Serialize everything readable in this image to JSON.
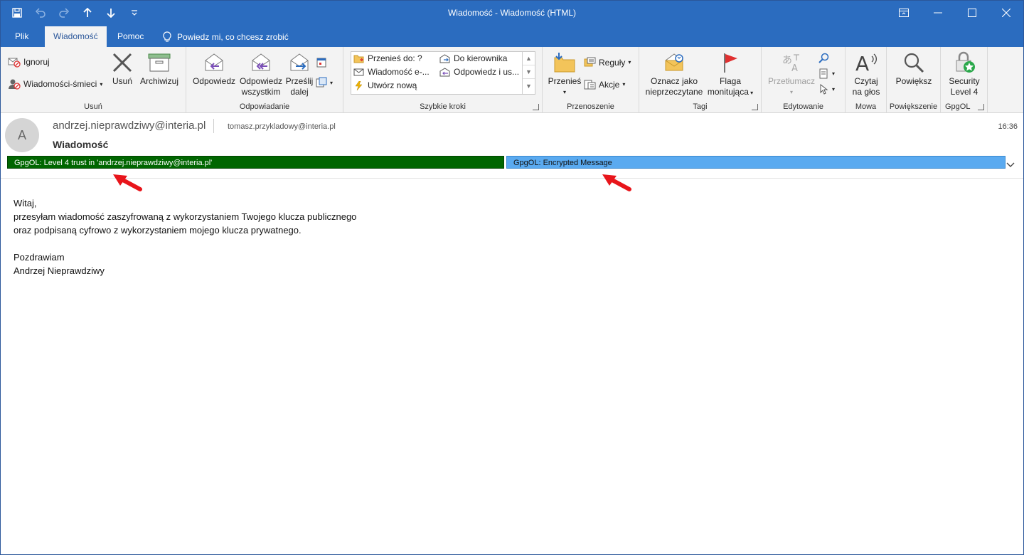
{
  "window": {
    "title": "Wiadomość  -  Wiadomość (HTML)"
  },
  "tabs": {
    "plik": "Plik",
    "wiadomosc": "Wiadomość",
    "pomoc": "Pomoc",
    "tell_me": "Powiedz mi, co chcesz zrobić"
  },
  "ribbon": {
    "usun": {
      "label": "Usuń",
      "ignoruj": "Ignoruj",
      "wiadomosci_smieci": "Wiadomości-śmieci",
      "usun": "Usuń",
      "archiwizuj": "Archiwizuj"
    },
    "odpowiadanie": {
      "label": "Odpowiadanie",
      "odpowiedz": "Odpowiedz",
      "odpowiedz_wszystkim_1": "Odpowiedz",
      "odpowiedz_wszystkim_2": "wszystkim",
      "przeslij_1": "Prześlij",
      "przeslij_2": "dalej"
    },
    "szybkie_kroki": {
      "label": "Szybkie kroki",
      "przenies_do": "Przenieś do: ?",
      "wiadomosc_e": "Wiadomość e-...",
      "utworz_nowa": "Utwórz nową",
      "do_kierownika": "Do kierownika",
      "odpowiedz_i_us": "Odpowiedz i us..."
    },
    "przenoszenie": {
      "label": "Przenoszenie",
      "przenies": "Przenieś",
      "reguly": "Reguły",
      "akcje": "Akcje"
    },
    "tagi": {
      "label": "Tagi",
      "oznacz_1": "Oznacz jako",
      "oznacz_2": "nieprzeczytane",
      "flaga_1": "Flaga",
      "flaga_2": "monitująca"
    },
    "edytowanie": {
      "label": "Edytowanie",
      "przetlumacz": "Przetłumacz"
    },
    "mowa": {
      "label": "Mowa",
      "czytaj_1": "Czytaj",
      "czytaj_2": "na głos"
    },
    "powiekszenie": {
      "label": "Powiększenie",
      "powieksz": "Powiększ"
    },
    "gpgol": {
      "label": "GpgOL",
      "security_1": "Security",
      "security_2": "Level 4"
    }
  },
  "message": {
    "avatar_initial": "A",
    "from": "andrzej.nieprawdziwy@interia.pl",
    "to": "tomasz.przykladowy@interia.pl",
    "subject": "Wiadomość",
    "time": "16:36",
    "gpg_trust": "GpgOL: Level 4 trust in 'andrzej.nieprawdziwy@interia.pl'",
    "gpg_encrypted": "GpgOL: Encrypted Message",
    "body": [
      "Witaj,",
      "przesyłam wiadomość zaszyfrowaną z wykorzystaniem Twojego klucza publicznego",
      "oraz podpisaną cyfrowo z wykorzystaniem mojego klucza prywatnego.",
      "",
      "Pozdrawiam",
      "Andrzej Nieprawdziwy"
    ]
  },
  "colors": {
    "titlebar": "#2b6cbf",
    "trust_bar": "#006600",
    "encrypted_bar": "#5aaaf0",
    "annotation_arrow": "#e8151b"
  }
}
